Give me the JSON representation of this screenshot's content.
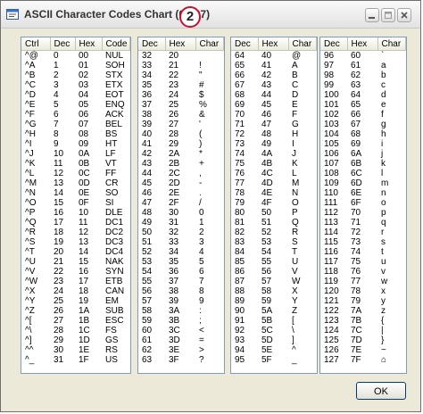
{
  "window": {
    "title": "ASCII Character Codes Chart (0-127)",
    "badge": "2",
    "ok_label": "OK"
  },
  "panels": [
    {
      "headers": [
        "Ctrl",
        "Dec",
        "Hex",
        "Code"
      ],
      "rows": [
        [
          "^@",
          "0",
          "00",
          "NUL"
        ],
        [
          "^A",
          "1",
          "01",
          "SOH"
        ],
        [
          "^B",
          "2",
          "02",
          "STX"
        ],
        [
          "^C",
          "3",
          "03",
          "ETX"
        ],
        [
          "^D",
          "4",
          "04",
          "EOT"
        ],
        [
          "^E",
          "5",
          "05",
          "ENQ"
        ],
        [
          "^F",
          "6",
          "06",
          "ACK"
        ],
        [
          "^G",
          "7",
          "07",
          "BEL"
        ],
        [
          "^H",
          "8",
          "08",
          "BS"
        ],
        [
          "^I",
          "9",
          "09",
          "HT"
        ],
        [
          "^J",
          "10",
          "0A",
          "LF"
        ],
        [
          "^K",
          "11",
          "0B",
          "VT"
        ],
        [
          "^L",
          "12",
          "0C",
          "FF"
        ],
        [
          "^M",
          "13",
          "0D",
          "CR"
        ],
        [
          "^N",
          "14",
          "0E",
          "SO"
        ],
        [
          "^O",
          "15",
          "0F",
          "SI"
        ],
        [
          "^P",
          "16",
          "10",
          "DLE"
        ],
        [
          "^Q",
          "17",
          "11",
          "DC1"
        ],
        [
          "^R",
          "18",
          "12",
          "DC2"
        ],
        [
          "^S",
          "19",
          "13",
          "DC3"
        ],
        [
          "^T",
          "20",
          "14",
          "DC4"
        ],
        [
          "^U",
          "21",
          "15",
          "NAK"
        ],
        [
          "^V",
          "22",
          "16",
          "SYN"
        ],
        [
          "^W",
          "23",
          "17",
          "ETB"
        ],
        [
          "^X",
          "24",
          "18",
          "CAN"
        ],
        [
          "^Y",
          "25",
          "19",
          "EM"
        ],
        [
          "^Z",
          "26",
          "1A",
          "SUB"
        ],
        [
          "^[",
          "27",
          "1B",
          "ESC"
        ],
        [
          "^\\",
          "28",
          "1C",
          "FS"
        ],
        [
          "^]",
          "29",
          "1D",
          "GS"
        ],
        [
          "^^",
          "30",
          "1E",
          "RS"
        ],
        [
          "^_",
          "31",
          "1F",
          "US"
        ]
      ]
    },
    {
      "headers": [
        "Dec",
        "Hex",
        "Char"
      ],
      "rows": [
        [
          "32",
          "20",
          ""
        ],
        [
          "33",
          "21",
          "!"
        ],
        [
          "34",
          "22",
          "\""
        ],
        [
          "35",
          "23",
          "#"
        ],
        [
          "36",
          "24",
          "$"
        ],
        [
          "37",
          "25",
          "%"
        ],
        [
          "38",
          "26",
          "&"
        ],
        [
          "39",
          "27",
          "'"
        ],
        [
          "40",
          "28",
          "("
        ],
        [
          "41",
          "29",
          ")"
        ],
        [
          "42",
          "2A",
          "*"
        ],
        [
          "43",
          "2B",
          "+"
        ],
        [
          "44",
          "2C",
          ","
        ],
        [
          "45",
          "2D",
          "-"
        ],
        [
          "46",
          "2E",
          "."
        ],
        [
          "47",
          "2F",
          "/"
        ],
        [
          "48",
          "30",
          "0"
        ],
        [
          "49",
          "31",
          "1"
        ],
        [
          "50",
          "32",
          "2"
        ],
        [
          "51",
          "33",
          "3"
        ],
        [
          "52",
          "34",
          "4"
        ],
        [
          "53",
          "35",
          "5"
        ],
        [
          "54",
          "36",
          "6"
        ],
        [
          "55",
          "37",
          "7"
        ],
        [
          "56",
          "38",
          "8"
        ],
        [
          "57",
          "39",
          "9"
        ],
        [
          "58",
          "3A",
          ":"
        ],
        [
          "59",
          "3B",
          ";"
        ],
        [
          "60",
          "3C",
          "<"
        ],
        [
          "61",
          "3D",
          "="
        ],
        [
          "62",
          "3E",
          ">"
        ],
        [
          "63",
          "3F",
          "?"
        ]
      ]
    },
    {
      "headers": [
        "Dec",
        "Hex",
        "Char"
      ],
      "rows": [
        [
          "64",
          "40",
          "@"
        ],
        [
          "65",
          "41",
          "A"
        ],
        [
          "66",
          "42",
          "B"
        ],
        [
          "67",
          "43",
          "C"
        ],
        [
          "68",
          "44",
          "D"
        ],
        [
          "69",
          "45",
          "E"
        ],
        [
          "70",
          "46",
          "F"
        ],
        [
          "71",
          "47",
          "G"
        ],
        [
          "72",
          "48",
          "H"
        ],
        [
          "73",
          "49",
          "I"
        ],
        [
          "74",
          "4A",
          "J"
        ],
        [
          "75",
          "4B",
          "K"
        ],
        [
          "76",
          "4C",
          "L"
        ],
        [
          "77",
          "4D",
          "M"
        ],
        [
          "78",
          "4E",
          "N"
        ],
        [
          "79",
          "4F",
          "O"
        ],
        [
          "80",
          "50",
          "P"
        ],
        [
          "81",
          "51",
          "Q"
        ],
        [
          "82",
          "52",
          "R"
        ],
        [
          "83",
          "53",
          "S"
        ],
        [
          "84",
          "54",
          "T"
        ],
        [
          "85",
          "55",
          "U"
        ],
        [
          "86",
          "56",
          "V"
        ],
        [
          "87",
          "57",
          "W"
        ],
        [
          "88",
          "58",
          "X"
        ],
        [
          "89",
          "59",
          "Y"
        ],
        [
          "90",
          "5A",
          "Z"
        ],
        [
          "91",
          "5B",
          "["
        ],
        [
          "92",
          "5C",
          "\\"
        ],
        [
          "93",
          "5D",
          "]"
        ],
        [
          "94",
          "5E",
          "^"
        ],
        [
          "95",
          "5F",
          "_"
        ]
      ]
    },
    {
      "headers": [
        "Dec",
        "Hex",
        "Char"
      ],
      "rows": [
        [
          "96",
          "60",
          "`"
        ],
        [
          "97",
          "61",
          "a"
        ],
        [
          "98",
          "62",
          "b"
        ],
        [
          "99",
          "63",
          "c"
        ],
        [
          "100",
          "64",
          "d"
        ],
        [
          "101",
          "65",
          "e"
        ],
        [
          "102",
          "66",
          "f"
        ],
        [
          "103",
          "67",
          "g"
        ],
        [
          "104",
          "68",
          "h"
        ],
        [
          "105",
          "69",
          "i"
        ],
        [
          "106",
          "6A",
          "j"
        ],
        [
          "107",
          "6B",
          "k"
        ],
        [
          "108",
          "6C",
          "l"
        ],
        [
          "109",
          "6D",
          "m"
        ],
        [
          "110",
          "6E",
          "n"
        ],
        [
          "111",
          "6F",
          "o"
        ],
        [
          "112",
          "70",
          "p"
        ],
        [
          "113",
          "71",
          "q"
        ],
        [
          "114",
          "72",
          "r"
        ],
        [
          "115",
          "73",
          "s"
        ],
        [
          "116",
          "74",
          "t"
        ],
        [
          "117",
          "75",
          "u"
        ],
        [
          "118",
          "76",
          "v"
        ],
        [
          "119",
          "77",
          "w"
        ],
        [
          "120",
          "78",
          "x"
        ],
        [
          "121",
          "79",
          "y"
        ],
        [
          "122",
          "7A",
          "z"
        ],
        [
          "123",
          "7B",
          "{"
        ],
        [
          "124",
          "7C",
          "|"
        ],
        [
          "125",
          "7D",
          "}"
        ],
        [
          "126",
          "7E",
          "~"
        ],
        [
          "127",
          "7F",
          "⌂"
        ]
      ]
    }
  ]
}
